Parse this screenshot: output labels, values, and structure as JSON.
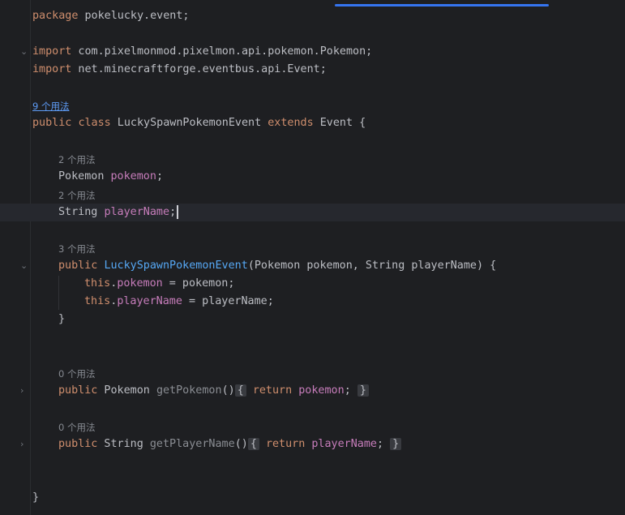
{
  "code": {
    "l1": {
      "k": "package",
      "t": " pokelucky.event;"
    },
    "l2": {
      "k": "import",
      "t": " com.pixelmonmod.pixelmon.api.pokemon.Pokemon;"
    },
    "l3": {
      "k": "import",
      "t": " net.minecraftforge.eventbus.api.Event;"
    },
    "hint_class": "9 个用法",
    "l4": {
      "k1": "public",
      "k2": "class",
      "name": " LuckySpawnPokemonEvent ",
      "k3": "extends",
      "t": " Event {"
    },
    "hint_f1": "2 个用法",
    "l5": {
      "type": "Pokemon ",
      "field": "pokemon",
      "t": ";"
    },
    "hint_f2": "2 个用法",
    "l6": {
      "type": "String ",
      "field": "playerName",
      "t": ";"
    },
    "hint_ctor": "3 个用法",
    "l7": {
      "k": "public",
      "name": "LuckySpawnPokemonEvent",
      "t": "(Pokemon pokemon, String playerName) {"
    },
    "l8": {
      "k": "this",
      "dot": ".",
      "field": "pokemon",
      "t": " = pokemon;"
    },
    "l9": {
      "k": "this",
      "dot": ".",
      "field": "playerName",
      "t": " = playerName;"
    },
    "l10": "}",
    "hint_m1": "0 个用法",
    "l11": {
      "k": "public",
      "type": " Pokemon ",
      "name": "getPokemon",
      "paren": "()",
      "open": "{",
      "ret": "return",
      "field": "pokemon",
      "semi": ";",
      "close": "}"
    },
    "hint_m2": "0 个用法",
    "l12": {
      "k": "public",
      "type": " String ",
      "name": "getPlayerName",
      "paren": "()",
      "open": "{",
      "ret": "return",
      "field": "playerName",
      "semi": ";",
      "close": "}"
    },
    "l13": "}"
  }
}
